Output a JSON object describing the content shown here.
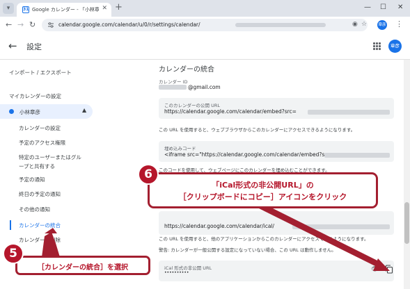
{
  "browser": {
    "tab_title": "Google カレンダー - 「小林章彦」の",
    "favicon_text": "31",
    "url": "calendar.google.com/calendar/u/0/r/settings/calendar/",
    "profile_initials": "章彦"
  },
  "header": {
    "title": "設定",
    "avatar_initials": "章彦"
  },
  "sidebar": {
    "import_export": "インポート / エクスポート",
    "my_calendars_heading": "マイカレンダーの設定",
    "calendar_name": "小林章彦",
    "items": [
      "カレンダーの設定",
      "予定のアクセス権限",
      "特定のユーザーまたはグループと共有する",
      "予定の通知",
      "終日の予定の通知",
      "その他の通知",
      "カレンダーの統合",
      "カレンダーを削除"
    ],
    "item_3_line1": "特定のユーザーまたはグル",
    "item_3_line2": "ープと共有する"
  },
  "main": {
    "section_title": "カレンダーの統合",
    "calendar_id_label": "カレンダー ID",
    "calendar_id_value": "@gmail.com",
    "public_url_label": "このカレンダーの公開 URL",
    "public_url_value": "https://calendar.google.com/calendar/embed?src=",
    "public_url_note": "この URL を使用すると、ウェブブラウザからこのカレンダーにアクセスできるようになります。",
    "embed_label": "埋め込みコード",
    "embed_value": "<iframe src=\"https://calendar.google.com/calendar/embed?src=",
    "embed_note": "このコードを使用して、ウェブページにこのカレンダーを埋め込むことができます。",
    "ical_public_value": "https://calendar.google.com/calendar/ical/",
    "ical_note": "この URL を使用すると、他のアプリケーションからこのカレンダーにアクセスできるようになります。",
    "warning": "警告: カレンダーが一般公開する設定になっていない場合、この URL は動作しません。",
    "secret_label": "iCal 形式の非公開 URL",
    "secret_value": "••••••••••"
  },
  "annotations": {
    "step6_number": "6",
    "step6_line1": "「iCal形式の非公開URL」の",
    "step6_line2": "［クリップボードにコピー］アイコンをクリック",
    "step5_number": "5",
    "step5_text": "［カレンダーの統合］を選択",
    "accent_color": "#b5162b"
  },
  "icons": [
    "tab-list-icon",
    "favicon-icon",
    "close-icon",
    "plus-icon",
    "minimize-icon",
    "maximize-icon",
    "back-icon",
    "forward-icon",
    "reload-icon",
    "site-info-icon",
    "eye-off-icon",
    "star-icon",
    "kebab-icon",
    "arrow-left-icon",
    "apps-grid-icon",
    "chevron-up-icon",
    "eye-icon",
    "copy-icon"
  ]
}
